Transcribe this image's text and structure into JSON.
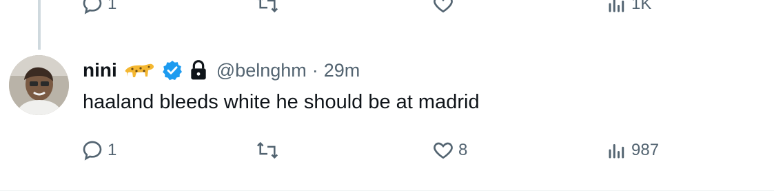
{
  "previous_tweet": {
    "reply_count": "1",
    "views": "1K"
  },
  "tweet": {
    "display_name": "nini",
    "handle": "@belnghm",
    "separator": "·",
    "time": "29m",
    "text": "haaland bleeds white he should be at madrid",
    "reply_count": "1",
    "like_count": "8",
    "views": "987"
  },
  "icons": {
    "emoji": "leopard-icon",
    "verified": "verified-badge-icon",
    "protected": "lock-icon",
    "reply": "reply-icon",
    "retweet": "retweet-icon",
    "like": "heart-icon",
    "views": "views-icon"
  },
  "colors": {
    "text_primary": "#0f1419",
    "text_secondary": "#536471",
    "verified_blue": "#1d9bf0",
    "thread_line": "#cfd9de"
  }
}
